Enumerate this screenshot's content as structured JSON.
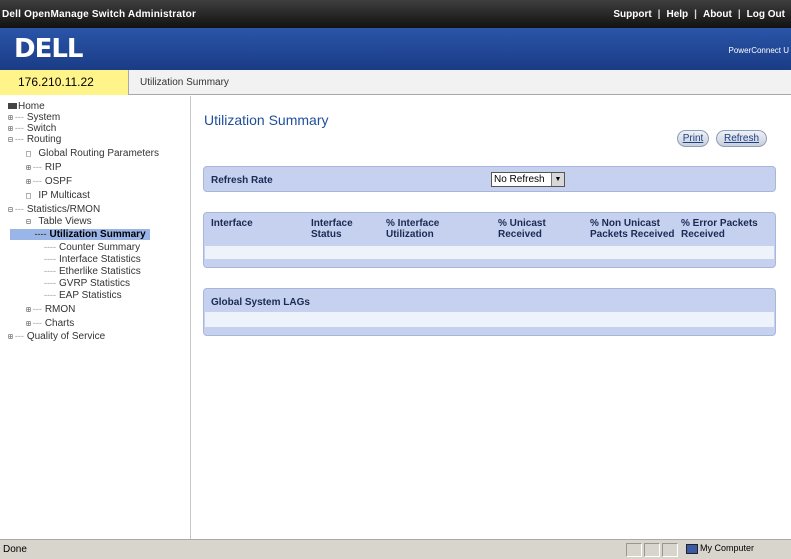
{
  "app": {
    "title": "Dell OpenManage Switch Administrator",
    "top_links": [
      "Support",
      "Help",
      "About",
      "Log Out"
    ]
  },
  "brand": {
    "logo": "DELL",
    "product": "PowerConnect U"
  },
  "address": {
    "ip": "176.210.11.22",
    "breadcrumb": "Utilization Summary"
  },
  "tree": {
    "home": "Home",
    "system": "System",
    "switch": "Switch",
    "routing": "Routing",
    "global_routing": "Global Routing Parameters",
    "rip": "RIP",
    "ospf": "OSPF",
    "ip_multicast": "IP Multicast",
    "stats": "Statistics/RMON",
    "table_views": "Table Views",
    "utilization_summary": "Utilization Summary",
    "counter_summary": "Counter Summary",
    "interface_statistics": "Interface Statistics",
    "etherlike_statistics": "Etherlike Statistics",
    "gvrp_statistics": "GVRP Statistics",
    "eap_statistics": "EAP Statistics",
    "rmon": "RMON",
    "charts": "Charts",
    "qos": "Quality of Service"
  },
  "main": {
    "title": "Utilization Summary",
    "print_label": "Print",
    "refresh_label": "Refresh",
    "refresh_rate_label": "Refresh Rate",
    "refresh_rate_value": "No Refresh",
    "columns": [
      {
        "line1": "Interface",
        "line2": ""
      },
      {
        "line1": "Interface",
        "line2": "Status"
      },
      {
        "line1": "% Interface",
        "line2": "Utilization"
      },
      {
        "line1": "% Unicast",
        "line2": "Received"
      },
      {
        "line1": "% Non Unicast",
        "line2": "Packets Received"
      },
      {
        "line1": "% Error Packets",
        "line2": "Received"
      }
    ],
    "lags_label": "Global System LAGs"
  },
  "status": {
    "text": "Done",
    "zone": "My Computer"
  }
}
